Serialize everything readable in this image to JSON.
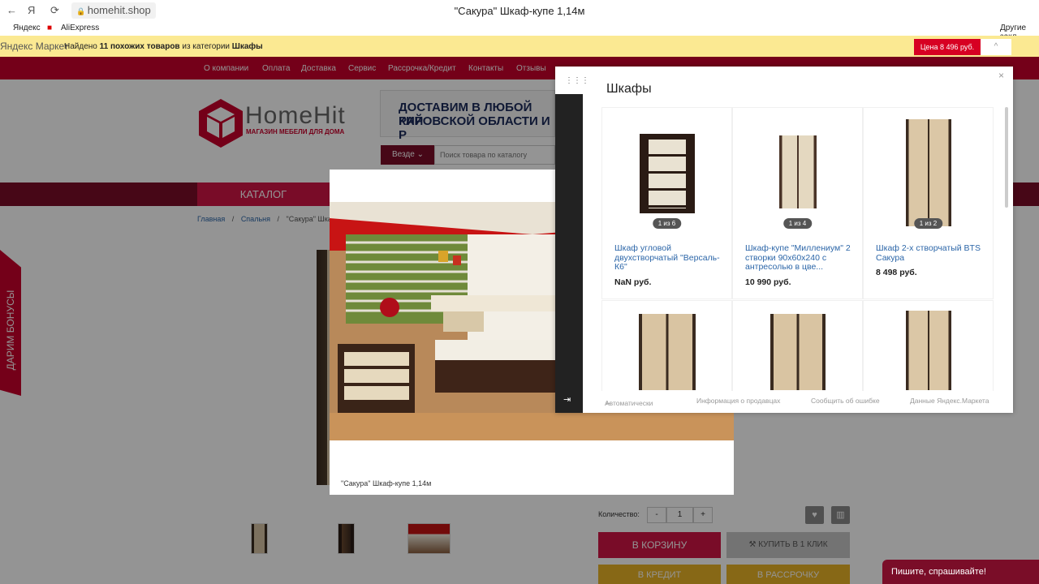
{
  "browser": {
    "back": "←",
    "yandex": "Я",
    "reload": "⟳",
    "url": "homehit.shop",
    "tab_title": "\"Сакура\" Шкаф-купе 1,14м",
    "bookmarks": [
      "Яндекс",
      "AliExpress"
    ],
    "other_bookmarks": "Другие закл"
  },
  "ym_bar": {
    "logo": "Яндекс Маркет",
    "message_prefix": "Найдено",
    "message_count": "11 похожих товаров",
    "message_mid": "из категории",
    "message_category": "Шкафы",
    "price_button": "Цена 8 496 руб.",
    "toggle": "^"
  },
  "site": {
    "nav": [
      "О компании",
      "Оплата",
      "Доставка",
      "Сервис",
      "Рассрочка/Кредит",
      "Контакты",
      "Отзывы"
    ],
    "logo_title": "HomeHit",
    "logo_subtitle": "МАГАЗИН МЕБЕЛИ ДЛЯ ДОМА",
    "banner_line1": "ДОСТАВИМ В ЛЮБОЙ РАЙ",
    "banner_line2": "КИРОВСКОЙ ОБЛАСТИ И Р",
    "search_scope": "Везде",
    "search_placeholder": "Поиск товара по каталогу",
    "catalog": "КАТАЛОГ",
    "breadcrumb": [
      "Главная",
      "/",
      "Спальня",
      "/",
      "\"Сакура\" Шкаф"
    ],
    "bonus": "ДАРИМ БОНУСЫ",
    "qty_label": "Количество:",
    "qty_minus": "-",
    "qty_value": "1",
    "qty_plus": "+",
    "fav_icon": "♥",
    "compare_icon": "▥",
    "cart": "В КОРЗИНУ",
    "one_click": "КУПИТЬ В 1 КЛИК",
    "credit": "В КРЕДИТ",
    "installment": "В РАССРОЧКУ",
    "chat": "Пишите, спрашивайте!"
  },
  "lightbox": {
    "caption": "\"Сакура\" Шкаф-купе 1,14м"
  },
  "ym_popup": {
    "heading": "Шкафы",
    "grid_icon": "⋮⋮⋮",
    "close": "×",
    "exit_icon": "⇥",
    "products": [
      {
        "title": "Шкаф угловой двухстворчатый \"Версаль-К6\"",
        "price": "NaN руб.",
        "count": "1 из 6"
      },
      {
        "title": "Шкаф-купе \"Миллениум\" 2 створки 90х60х240 с антресолью в цве...",
        "price": "10 990 руб.",
        "count": "1 из 4"
      },
      {
        "title": "Шкаф 2-х створчатый BTS Сакура",
        "price": "8 498 руб.",
        "count": "1 из 2"
      }
    ],
    "footer": {
      "auto": "Автоматически",
      "seller_info": "Информация о продавцах",
      "report": "Сообщить об ошибке",
      "data": "Данные Яндекс.Маркета"
    }
  },
  "colors": {
    "brand_red": "#c9002b",
    "brand_dark": "#7a0d28",
    "ym_yellow": "#fbe992",
    "link_blue": "#2c66a8"
  }
}
